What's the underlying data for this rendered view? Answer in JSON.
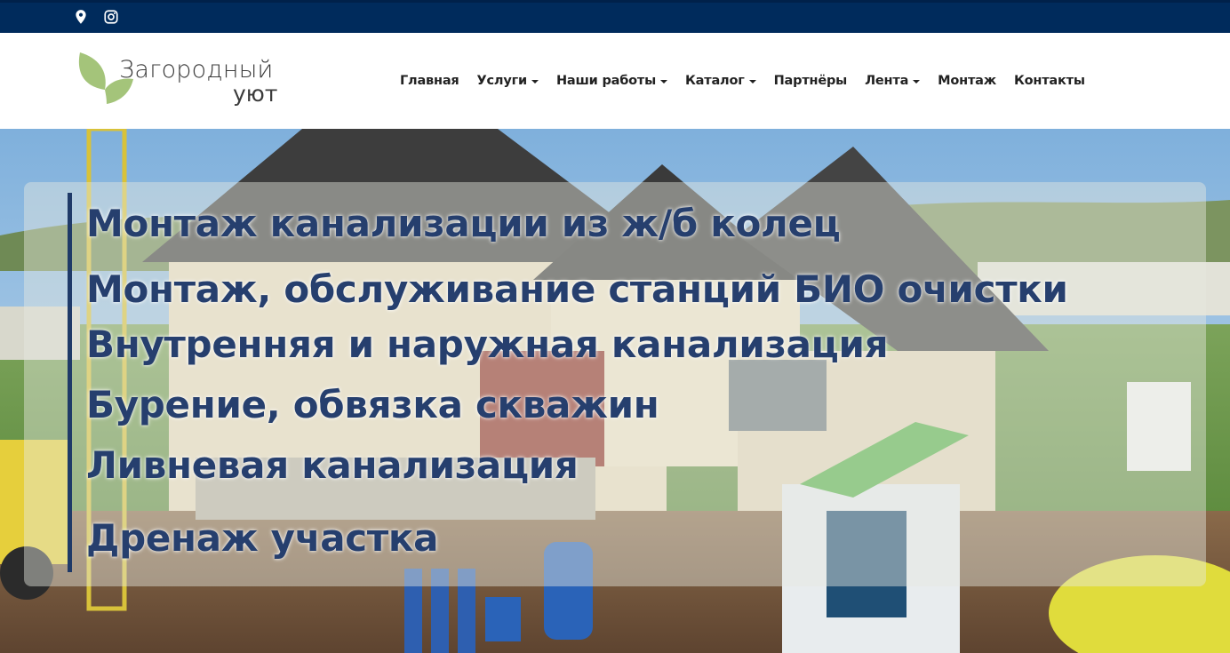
{
  "logo": {
    "line1": "Загородный",
    "line2": "уют"
  },
  "nav": {
    "items": [
      {
        "label": "Главная",
        "dropdown": false
      },
      {
        "label": "Услуги",
        "dropdown": true
      },
      {
        "label": "Наши работы",
        "dropdown": true
      },
      {
        "label": "Каталог",
        "dropdown": true
      },
      {
        "label": "Партнёры",
        "dropdown": false
      },
      {
        "label": "Лента",
        "dropdown": true
      },
      {
        "label": "Монтаж",
        "dropdown": false
      },
      {
        "label": "Контакты",
        "dropdown": false
      }
    ]
  },
  "hero": {
    "services": [
      "Монтаж канализации из ж/б колец",
      "Монтаж, обслуживание станций БИО очистки",
      "Внутренняя и наружная канализация",
      "Бурение, обвязка скважин",
      "Ливневая канализация",
      "Дренаж участка"
    ]
  },
  "icons": {
    "top_left": "map-pin-icon",
    "top_right": "instagram-icon",
    "caret": "chevron-down-icon"
  },
  "colors": {
    "topbar": "#002b5c",
    "heading": "#263f6e",
    "logo_leaf": "#a4c47a"
  }
}
